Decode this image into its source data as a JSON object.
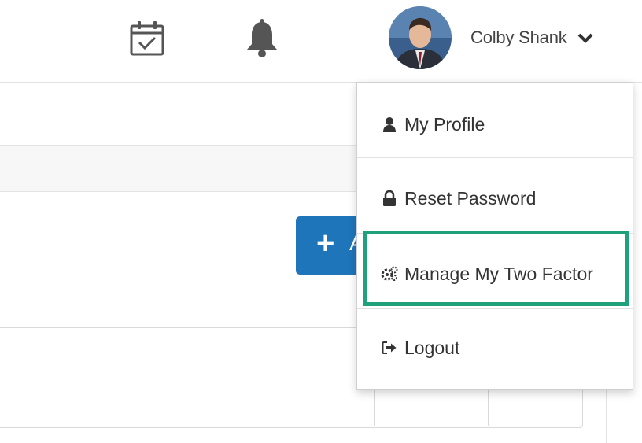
{
  "header": {
    "calendar_icon": "calendar-check-icon",
    "bell_icon": "bell-icon",
    "user": {
      "name": "Colby Shank",
      "avatar": "avatar-photo"
    }
  },
  "page": {
    "add_button": {
      "label": "+ A",
      "plus": "+",
      "text": "A"
    }
  },
  "user_menu": {
    "items": [
      {
        "label": "My Profile",
        "icon": "user-icon"
      },
      {
        "label": "Reset Password",
        "icon": "lock-icon"
      },
      {
        "label": "Manage My Two Factor",
        "icon": "gears-icon",
        "highlighted": true
      },
      {
        "label": "Logout",
        "icon": "sign-out-icon"
      }
    ]
  },
  "colors": {
    "accent": "#1f75b9",
    "highlight": "#1fa27b"
  }
}
